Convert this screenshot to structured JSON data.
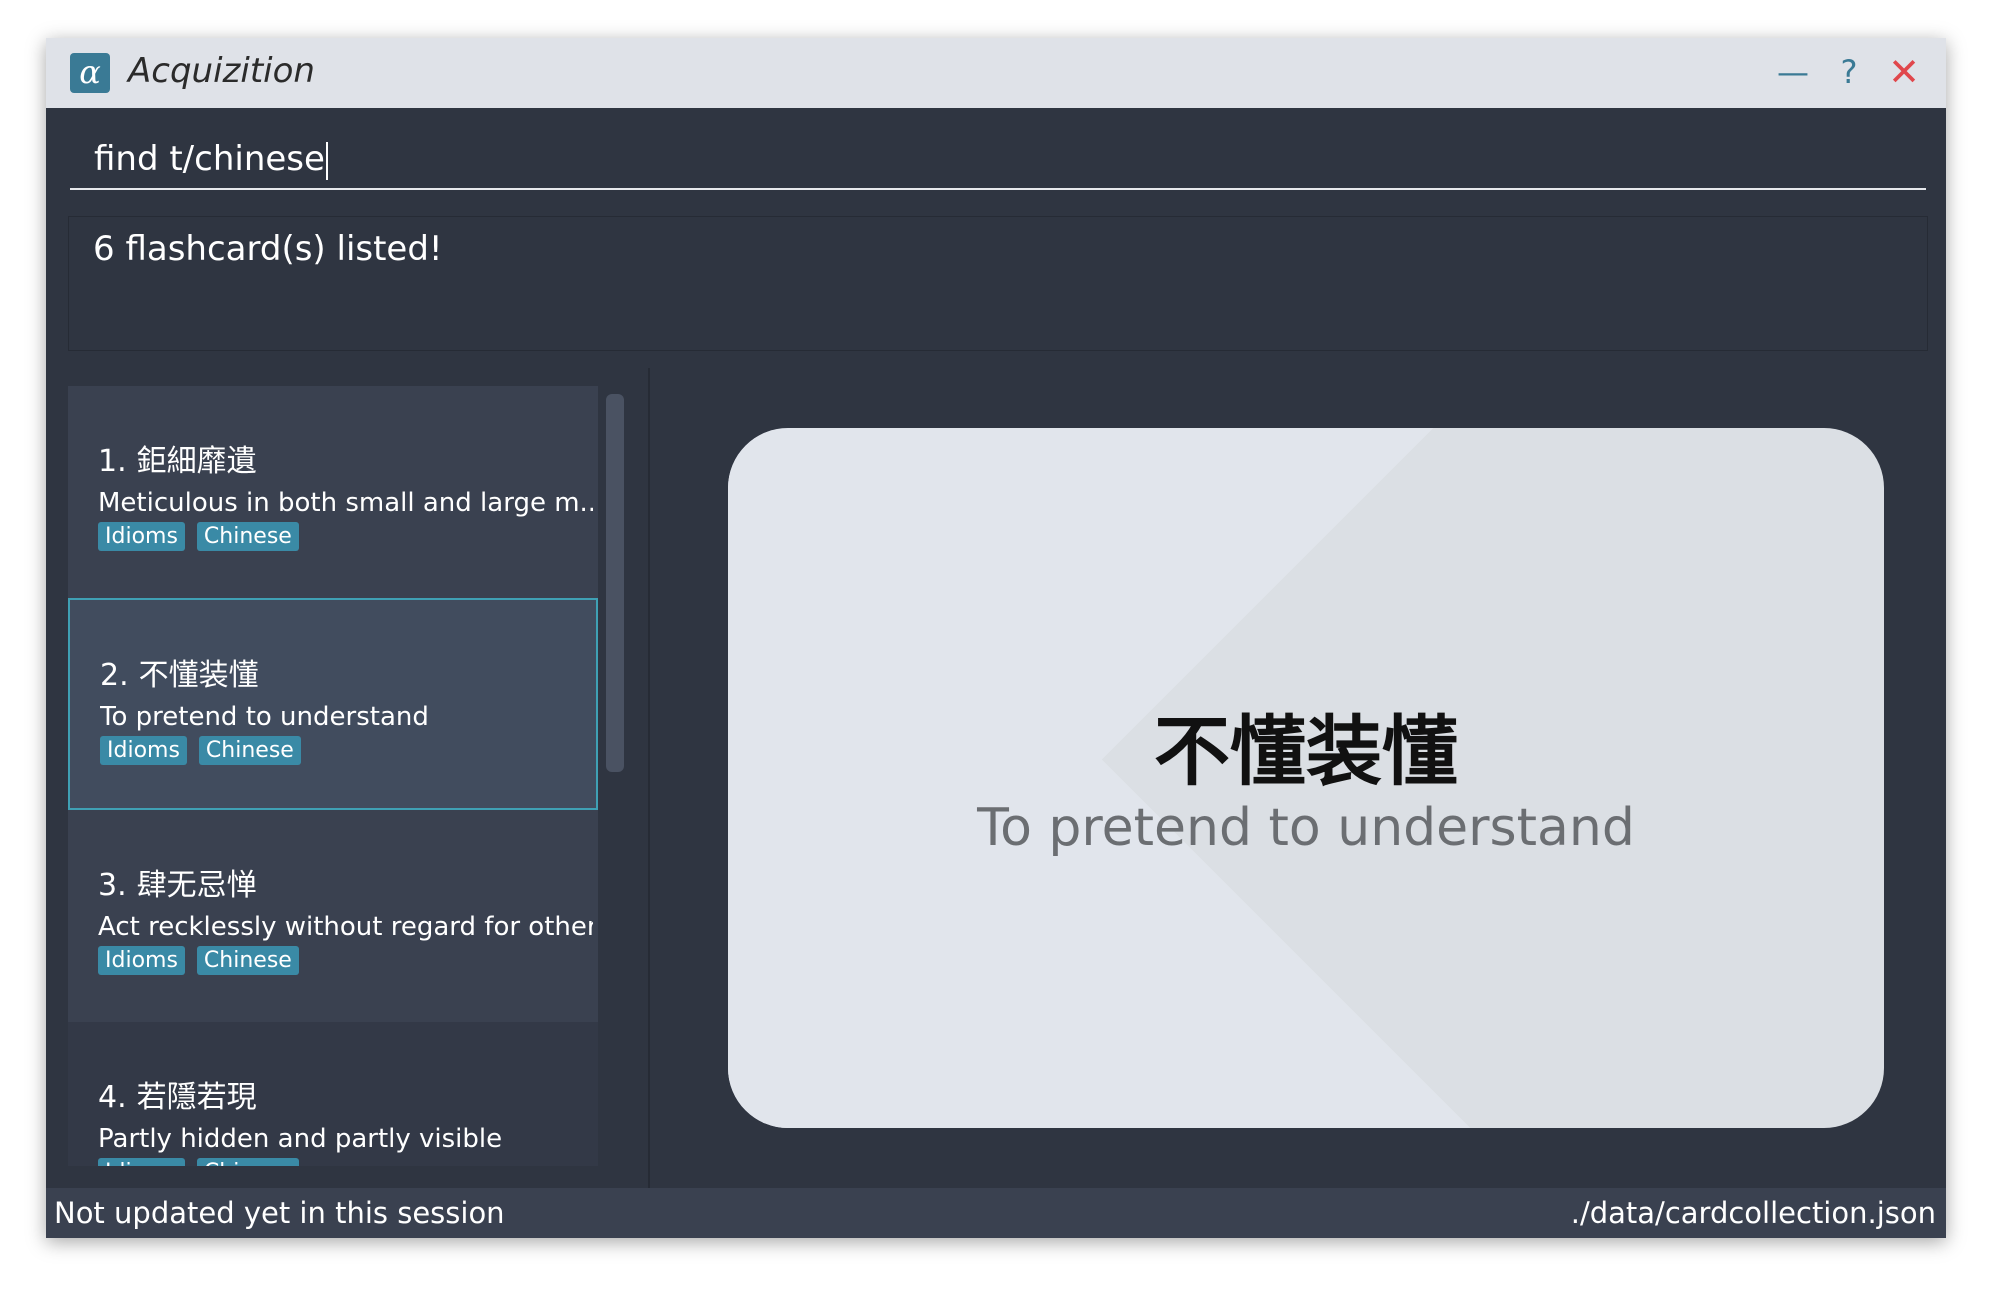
{
  "window": {
    "title": "Acquizition",
    "logo_glyph": "α",
    "minimize_glyph": "—",
    "help_glyph": "?",
    "close_glyph": "✕"
  },
  "command": {
    "value": "find t/chinese"
  },
  "result": {
    "message": "6 flashcard(s) listed!"
  },
  "cards": [
    {
      "index": "1.",
      "title": "鉅細靡遺",
      "description": "Meticulous in both small and large m...",
      "tags": [
        "Idioms",
        "Chinese"
      ]
    },
    {
      "index": "2.",
      "title": "不懂装懂",
      "description": "To pretend to understand",
      "tags": [
        "Idioms",
        "Chinese"
      ]
    },
    {
      "index": "3.",
      "title": "肆无忌惮",
      "description": "Act recklessly without regard for others",
      "tags": [
        "Idioms",
        "Chinese"
      ]
    },
    {
      "index": "4.",
      "title": "若隱若現",
      "description": "Partly hidden and partly visible",
      "tags": [
        "Idioms",
        "Chinese"
      ]
    }
  ],
  "flashcard": {
    "question": "不懂装懂",
    "answer": "To pretend to understand"
  },
  "status": {
    "left": "Not updated yet in this session",
    "right": "./data/cardcollection.json"
  },
  "colors": {
    "accent": "#3a7a95",
    "tag": "#3a8aa6",
    "selected_border": "#3fa0b4",
    "close": "#e0474c"
  }
}
